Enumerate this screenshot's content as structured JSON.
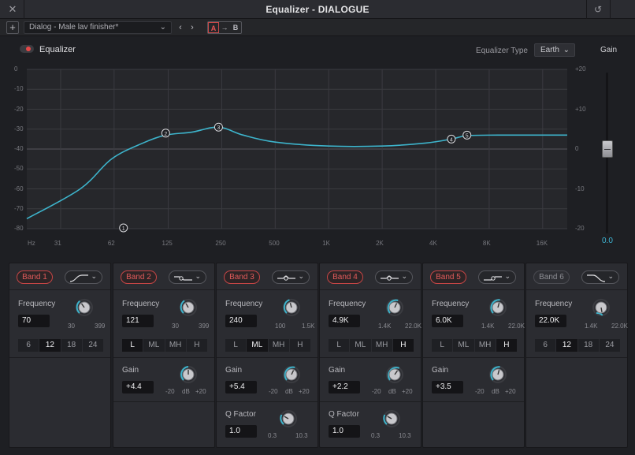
{
  "window": {
    "title": "Equalizer - DIALOGUE",
    "close_glyph": "✕",
    "reset_glyph": "↺"
  },
  "preset_bar": {
    "add_glyph": "+",
    "preset_name": "Dialog - Male lav finisher*",
    "prev_glyph": "‹",
    "next_glyph": "›",
    "ab": {
      "a": "A",
      "arrow": "→",
      "b": "B"
    }
  },
  "header": {
    "equalizer_label": "Equalizer",
    "equalizer_enabled": true,
    "eq_type_label": "Equalizer Type",
    "eq_type_value": "Earth",
    "gain_label": "Gain"
  },
  "graph": {
    "y_left_labels": [
      "0",
      "-10",
      "-20",
      "-30",
      "-40",
      "-50",
      "-60",
      "-70",
      "-80"
    ],
    "y_right_labels": [
      "+20",
      "+10",
      "0",
      "-10",
      "-20"
    ],
    "x_labels": [
      "Hz",
      "31",
      "62",
      "125",
      "250",
      "500",
      "1K",
      "2K",
      "4K",
      "8K",
      "16K"
    ],
    "curve_color": "#3db4cc",
    "nodes": [
      {
        "label": "1",
        "freq_hz": 70,
        "gain_db": -80
      },
      {
        "label": "2",
        "freq_hz": 121,
        "gain_db": -32
      },
      {
        "label": "3",
        "freq_hz": 240,
        "gain_db": -29
      },
      {
        "label": "4",
        "freq_hz": 4900,
        "gain_db": -35
      },
      {
        "label": "5",
        "freq_hz": 6000,
        "gain_db": -33
      }
    ]
  },
  "gain_fader": {
    "value": "0.0",
    "level_db": 0
  },
  "bands": [
    {
      "name": "Band 1",
      "enabled": true,
      "shape_icon": "high-pass-icon",
      "frequency_label": "Frequency",
      "frequency": "70",
      "freq_min": "30",
      "freq_max": "399",
      "slope_options": [
        "6",
        "12",
        "18",
        "24"
      ],
      "slope_selected": "12"
    },
    {
      "name": "Band 2",
      "enabled": true,
      "shape_icon": "low-shelf-icon",
      "frequency_label": "Frequency",
      "frequency": "121",
      "freq_min": "30",
      "freq_max": "399",
      "type_options": [
        "L",
        "ML",
        "MH",
        "H"
      ],
      "type_selected": "L",
      "gain_label": "Gain",
      "gain": "+4.4",
      "gain_min": "-20",
      "gain_unit": "dB",
      "gain_max": "+20"
    },
    {
      "name": "Band 3",
      "enabled": true,
      "shape_icon": "bell-icon",
      "frequency_label": "Frequency",
      "frequency": "240",
      "freq_min": "100",
      "freq_max": "1.5K",
      "type_options": [
        "L",
        "ML",
        "MH",
        "H"
      ],
      "type_selected": "ML",
      "gain_label": "Gain",
      "gain": "+5.4",
      "gain_min": "-20",
      "gain_unit": "dB",
      "gain_max": "+20",
      "q_label": "Q Factor",
      "q": "1.0",
      "q_min": "0.3",
      "q_max": "10.3"
    },
    {
      "name": "Band 4",
      "enabled": true,
      "shape_icon": "bell-icon",
      "frequency_label": "Frequency",
      "frequency": "4.9K",
      "freq_min": "1.4K",
      "freq_max": "22.0K",
      "type_options": [
        "L",
        "ML",
        "MH",
        "H"
      ],
      "type_selected": "H",
      "gain_label": "Gain",
      "gain": "+2.2",
      "gain_min": "-20",
      "gain_unit": "dB",
      "gain_max": "+20",
      "q_label": "Q Factor",
      "q": "1.0",
      "q_min": "0.3",
      "q_max": "10.3"
    },
    {
      "name": "Band 5",
      "enabled": true,
      "shape_icon": "high-shelf-icon",
      "frequency_label": "Frequency",
      "frequency": "6.0K",
      "freq_min": "1.4K",
      "freq_max": "22.0K",
      "type_options": [
        "L",
        "ML",
        "MH",
        "H"
      ],
      "type_selected": "H",
      "gain_label": "Gain",
      "gain": "+3.5",
      "gain_min": "-20",
      "gain_unit": "dB",
      "gain_max": "+20"
    },
    {
      "name": "Band 6",
      "enabled": false,
      "shape_icon": "low-pass-icon",
      "frequency_label": "Frequency",
      "frequency": "22.0K",
      "freq_min": "1.4K",
      "freq_max": "22.0K",
      "slope_options": [
        "6",
        "12",
        "18",
        "24"
      ],
      "slope_selected": "12"
    }
  ]
}
